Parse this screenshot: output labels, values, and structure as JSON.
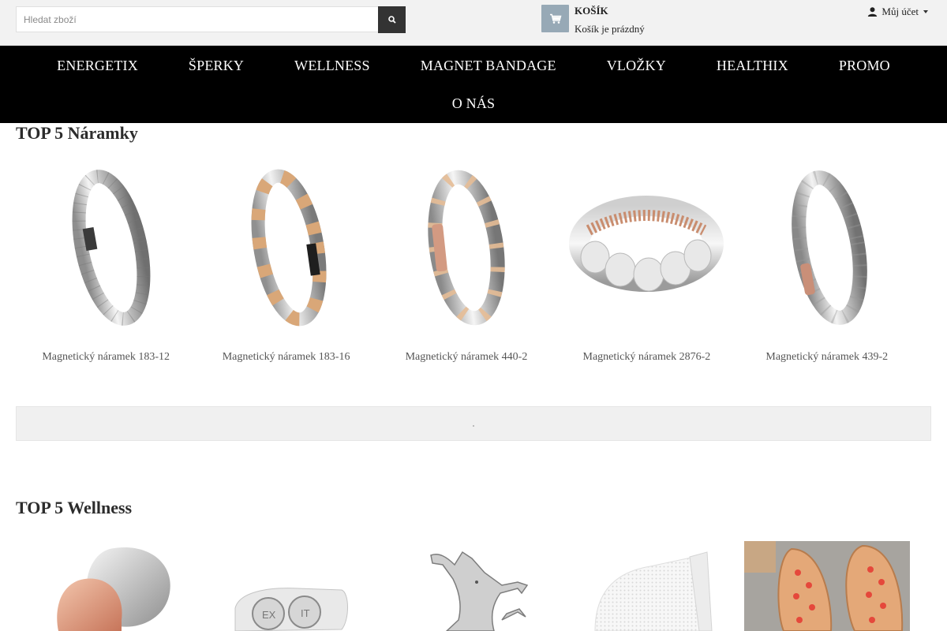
{
  "header": {
    "search_placeholder": "Hledat zboží",
    "cart_title": "KOŠÍK",
    "cart_status": "Košík je prázdný",
    "account_label": "Můj účet"
  },
  "nav": {
    "row1": [
      "ENERGETIX",
      "ŠPERKY",
      "WELLNESS",
      "MAGNET BANDAGE",
      "VLOŽKY",
      "HEALTHIX",
      "PROMO"
    ],
    "row2": [
      "O NÁS"
    ]
  },
  "sections": [
    {
      "title": "TOP 5 Náramky",
      "products": [
        {
          "name": "Magnetický náramek 183-12"
        },
        {
          "name": "Magnetický náramek 183-16"
        },
        {
          "name": "Magnetický náramek 440-2"
        },
        {
          "name": "Magnetický náramek 2876-2"
        },
        {
          "name": "Magnetický náramek 439-2"
        }
      ]
    },
    {
      "title": "TOP 5 Wellness",
      "products": [
        {
          "name": ""
        },
        {
          "name": ""
        },
        {
          "name": ""
        },
        {
          "name": ""
        },
        {
          "name": ""
        }
      ]
    }
  ],
  "colors": {
    "topbar_bg": "#f2f2f2",
    "nav_bg": "#000000",
    "cart_icon_bg": "#97a9b6",
    "search_button_bg": "#333333",
    "banner_bg": "#f0f0f0"
  },
  "icons": {
    "search": "search-icon",
    "cart": "cart-icon",
    "account": "user-icon",
    "account_caret": "caret-down-icon"
  }
}
